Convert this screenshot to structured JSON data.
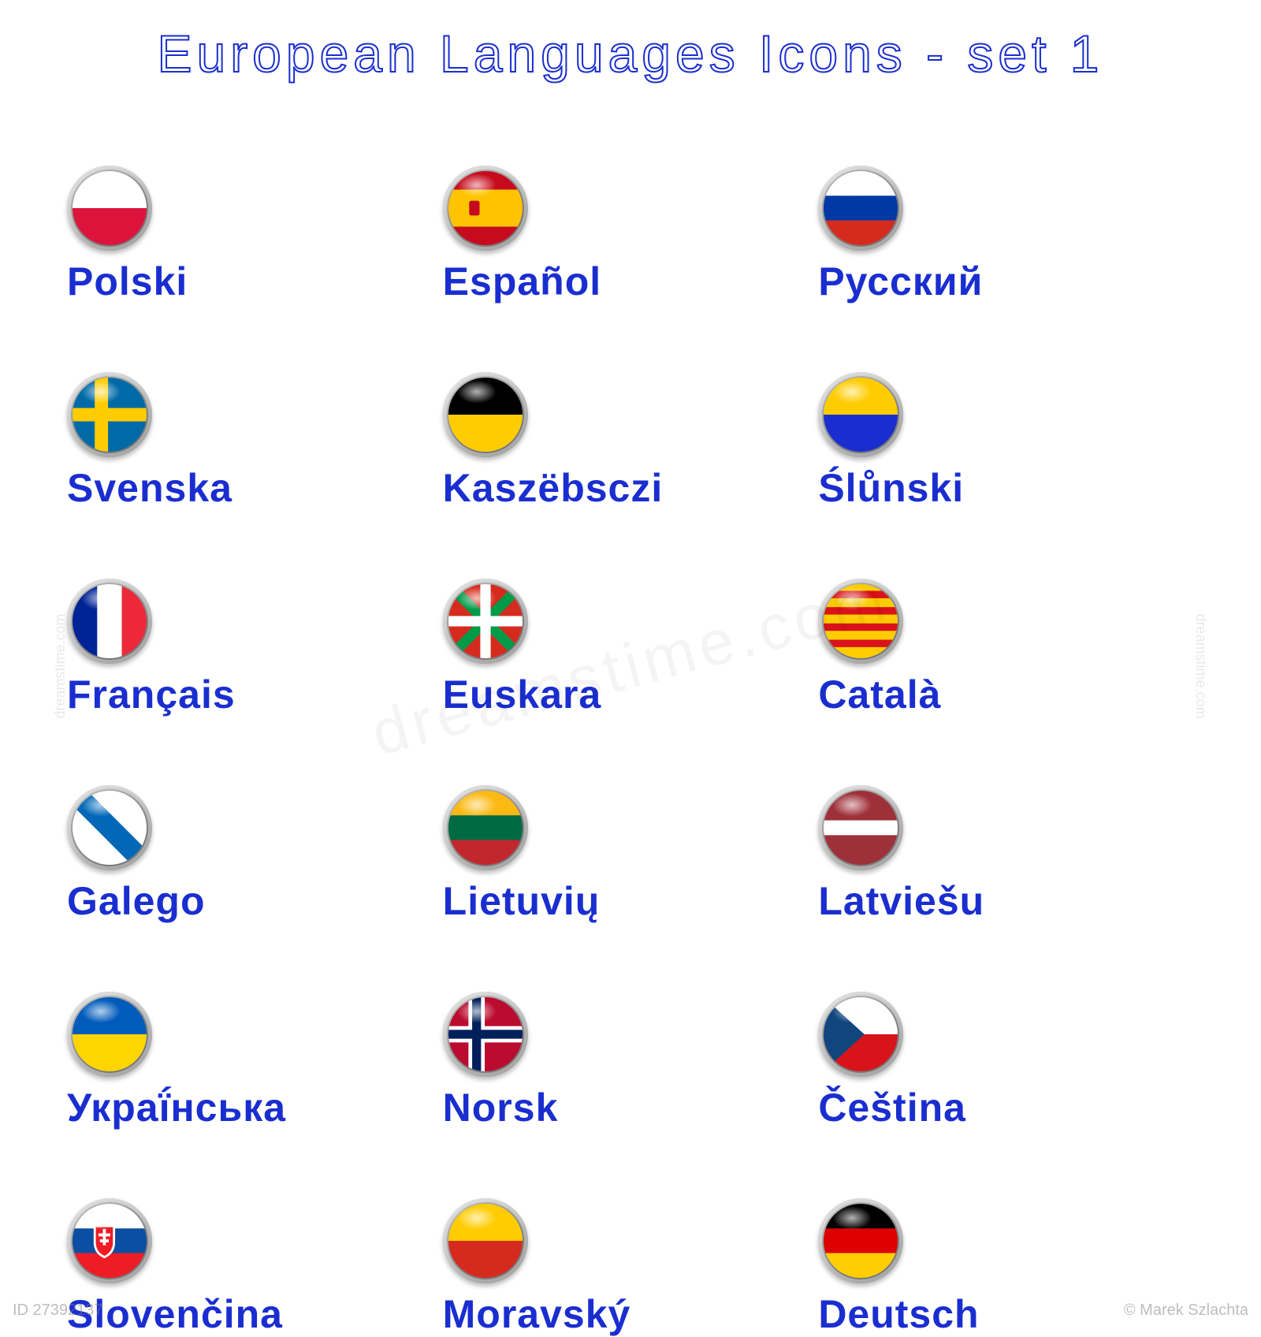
{
  "title": "European Languages Icons - set 1",
  "watermark": {
    "id": "ID 27392137",
    "credit": "© Marek Szlachta",
    "side": "dreamstime.com",
    "center": "dreamstime.com"
  },
  "items": [
    {
      "label": "Polski",
      "flag": "poland"
    },
    {
      "label": "Español",
      "flag": "spain"
    },
    {
      "label": "Русский",
      "flag": "russia"
    },
    {
      "label": "Svenska",
      "flag": "sweden"
    },
    {
      "label": "Kaszëbsczi",
      "flag": "kashubia"
    },
    {
      "label": "Ślůnski",
      "flag": "silesia"
    },
    {
      "label": "Français",
      "flag": "france"
    },
    {
      "label": "Euskara",
      "flag": "basque"
    },
    {
      "label": "Català",
      "flag": "catalonia"
    },
    {
      "label": "Galego",
      "flag": "galicia"
    },
    {
      "label": "Lietuvių",
      "flag": "lithuania"
    },
    {
      "label": "Latviešu",
      "flag": "latvia"
    },
    {
      "label": "Украḯнська",
      "flag": "ukraine"
    },
    {
      "label": "Norsk",
      "flag": "norway"
    },
    {
      "label": "Čeština",
      "flag": "czech"
    },
    {
      "label": "Slovenčina",
      "flag": "slovakia"
    },
    {
      "label": "Moravský",
      "flag": "moravia"
    },
    {
      "label": "Deutsch",
      "flag": "germany"
    }
  ]
}
